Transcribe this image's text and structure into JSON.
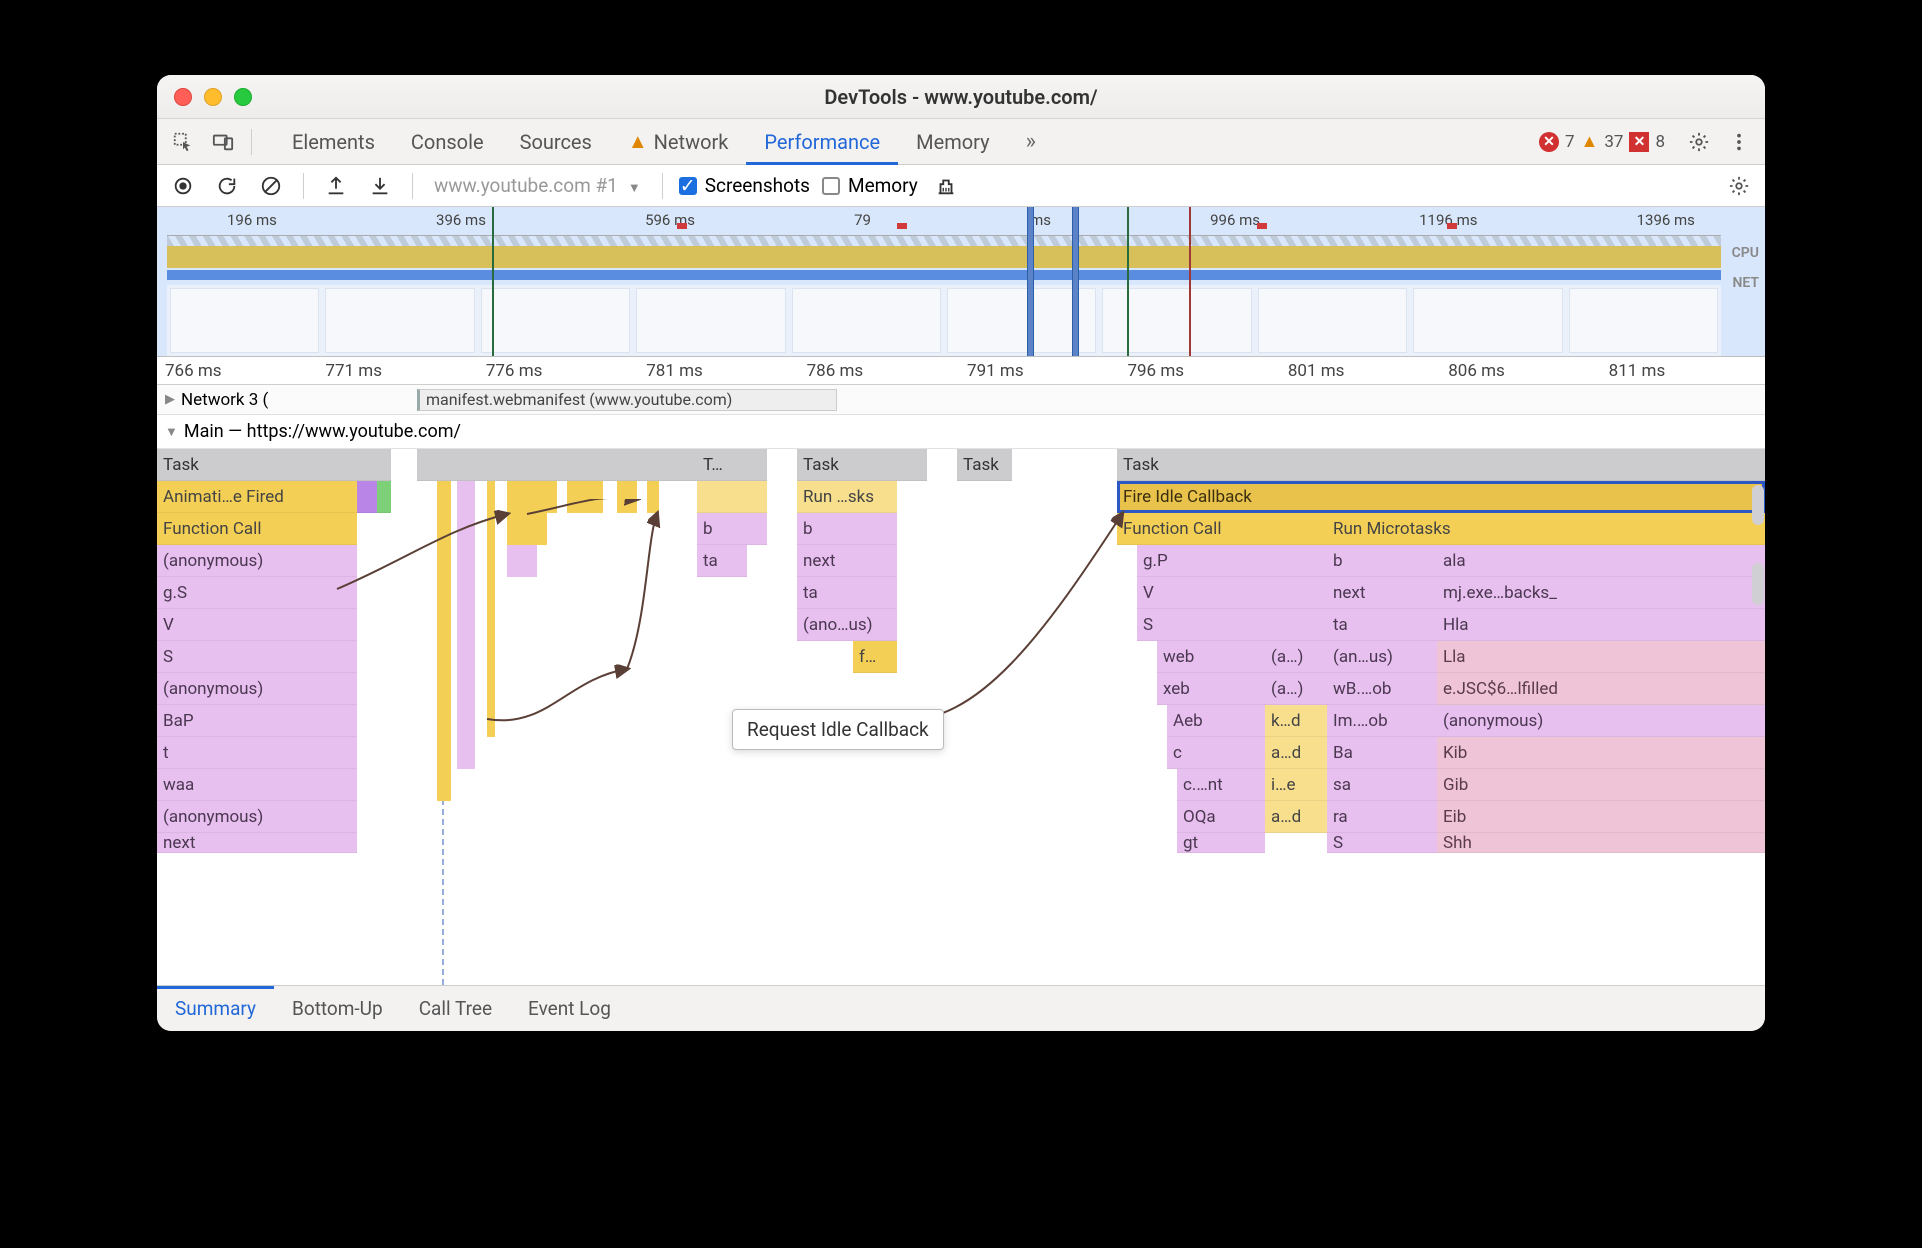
{
  "window_title": "DevTools - www.youtube.com/",
  "panels": {
    "tabs": [
      "Elements",
      "Console",
      "Sources",
      "Network",
      "Performance",
      "Memory"
    ],
    "active": "Performance",
    "network_has_warning": true,
    "overflow_hint": "»"
  },
  "issues": {
    "errors": 7,
    "warnings": 37,
    "cross": 8
  },
  "perf_toolbar": {
    "recording_label": "www.youtube.com #1",
    "screenshots_label": "Screenshots",
    "screenshots_checked": true,
    "memory_label": "Memory",
    "memory_checked": false
  },
  "overview": {
    "ticks": [
      "196 ms",
      "396 ms",
      "596 ms",
      "79",
      "ms",
      "996 ms",
      "1196 ms",
      "1396 ms"
    ],
    "cpu_label": "CPU",
    "net_label": "NET"
  },
  "ruler": {
    "ticks": [
      "766 ms",
      "771 ms",
      "776 ms",
      "781 ms",
      "786 ms",
      "791 ms",
      "796 ms",
      "801 ms",
      "806 ms",
      "811 ms"
    ]
  },
  "network_lane": {
    "title": "Network 3 (",
    "item": "manifest.webmanifest (www.youtube.com)"
  },
  "main_header": "Main — https://www.youtube.com/",
  "tooltip": "Request Idle Callback",
  "flame": {
    "left": {
      "task": "Task",
      "rows": [
        "Animati…e Fired",
        "Function Call",
        "(anonymous)",
        "g.S",
        "V",
        "S",
        "(anonymous)",
        "BaP",
        "t",
        "waa",
        "(anonymous)",
        "next"
      ]
    },
    "mid_a": {
      "task": "T…",
      "rows": [
        "",
        "b",
        "ta"
      ]
    },
    "mid_b": {
      "task": "Task",
      "rows": [
        "Run …sks",
        "b",
        "next",
        "ta",
        "(ano…us)",
        "f…"
      ]
    },
    "mid_c": {
      "task": "Task"
    },
    "right": {
      "task": "Task",
      "fire": "Fire Idle Callback",
      "col1": [
        "Function Call",
        "g.P",
        "V",
        "S"
      ],
      "col1b": [
        "web",
        "xeb",
        "Aeb",
        "c",
        "c.…nt",
        "OQa",
        "gt"
      ],
      "col1c": [
        "(a…)",
        "(a…)",
        "k…d",
        "a…d",
        "i…e",
        "a…d"
      ],
      "col2_hdr": "Run Microtasks",
      "col2a": [
        "b",
        "next",
        "ta",
        "(an…us)",
        "wB.…ob",
        "Im.…ob",
        "Ba",
        "sa",
        "ra",
        "S"
      ],
      "col2b": [
        "ala",
        "mj.exe…backs_",
        "Hla",
        "Lla",
        "e.JSC$6…lfilled",
        "(anonymous)",
        "Kib",
        "Gib",
        "Eib",
        "Shh"
      ]
    }
  },
  "detail_tabs": [
    "Summary",
    "Bottom-Up",
    "Call Tree",
    "Event Log"
  ],
  "detail_active": "Summary"
}
